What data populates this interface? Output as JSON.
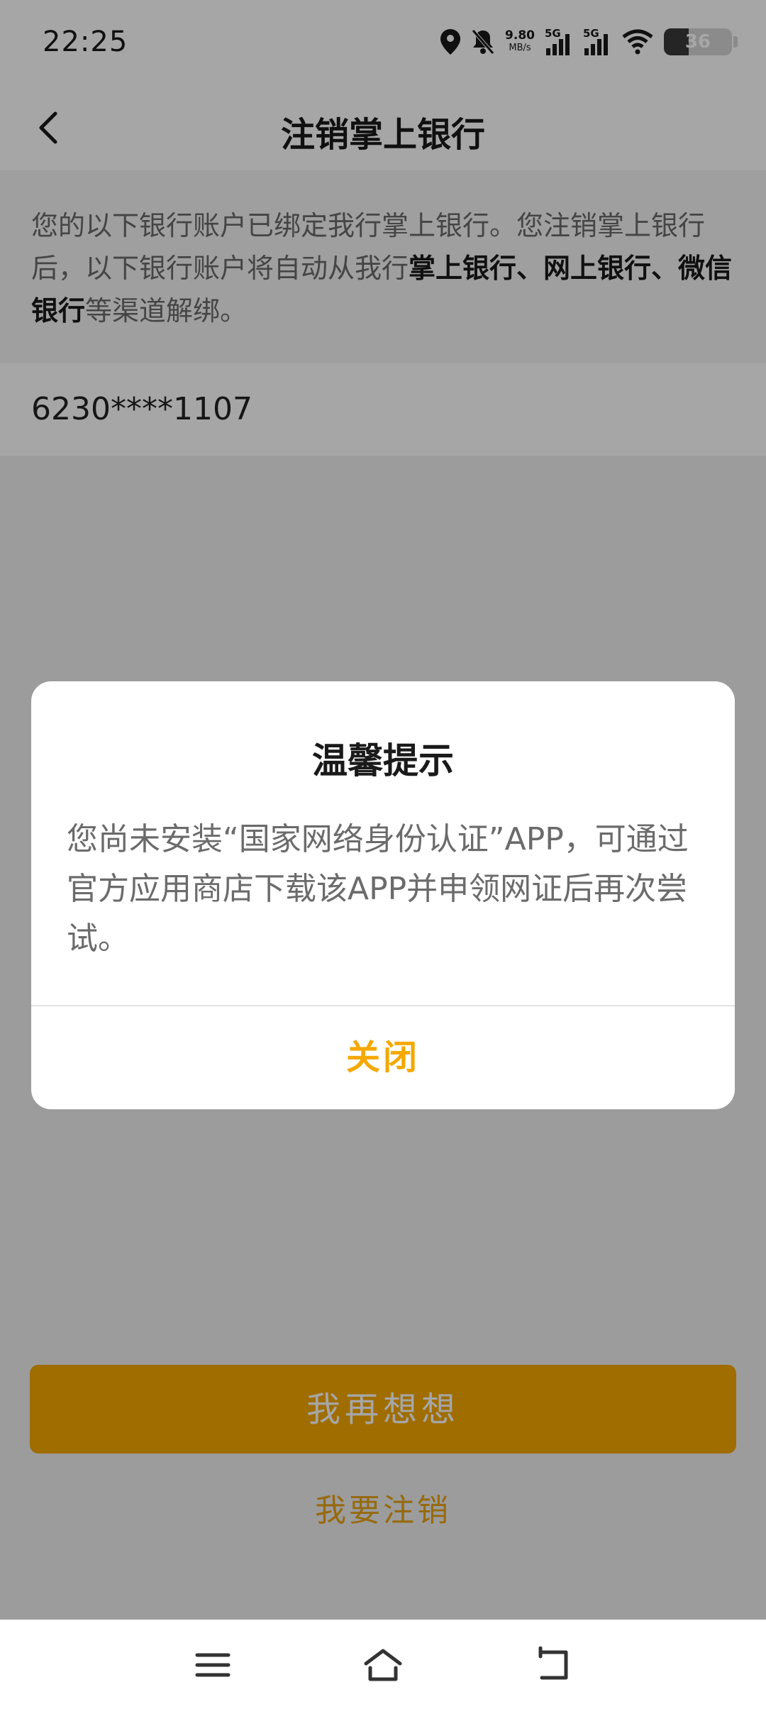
{
  "status_bar": {
    "time": "22:25",
    "net_speed_value": "9.80",
    "net_speed_unit": "MB/s",
    "sim1_label": "5G",
    "sim2_label": "5G",
    "battery": "36",
    "icons": [
      "location-icon",
      "mute-bell-icon",
      "signal-icon",
      "wifi-icon",
      "battery-icon"
    ]
  },
  "nav": {
    "title": "注销掌上银行",
    "back_icon": "chevron-left-icon"
  },
  "notice": {
    "text_pre": "您的以下银行账户已绑定我行掌上银行。您注销掌上银行后，以下银行账户将自动从我行",
    "text_bold": "掌上银行、网上银行、微信银行",
    "text_post": "等渠道解绑。"
  },
  "account_number": "6230****1107",
  "actions": {
    "primary_label": "我再想想",
    "secondary_label": "我要注销"
  },
  "dialog": {
    "title": "温馨提示",
    "message": "您尚未安装“国家网络身份认证”APP，可通过官方应用商店下载该APP并申领网证后再次尝试。",
    "close_label": "关闭"
  },
  "colors": {
    "accent": "#f4a800",
    "link": "#e7a316"
  },
  "system_nav": [
    "menu-icon",
    "home-icon",
    "back-icon"
  ]
}
